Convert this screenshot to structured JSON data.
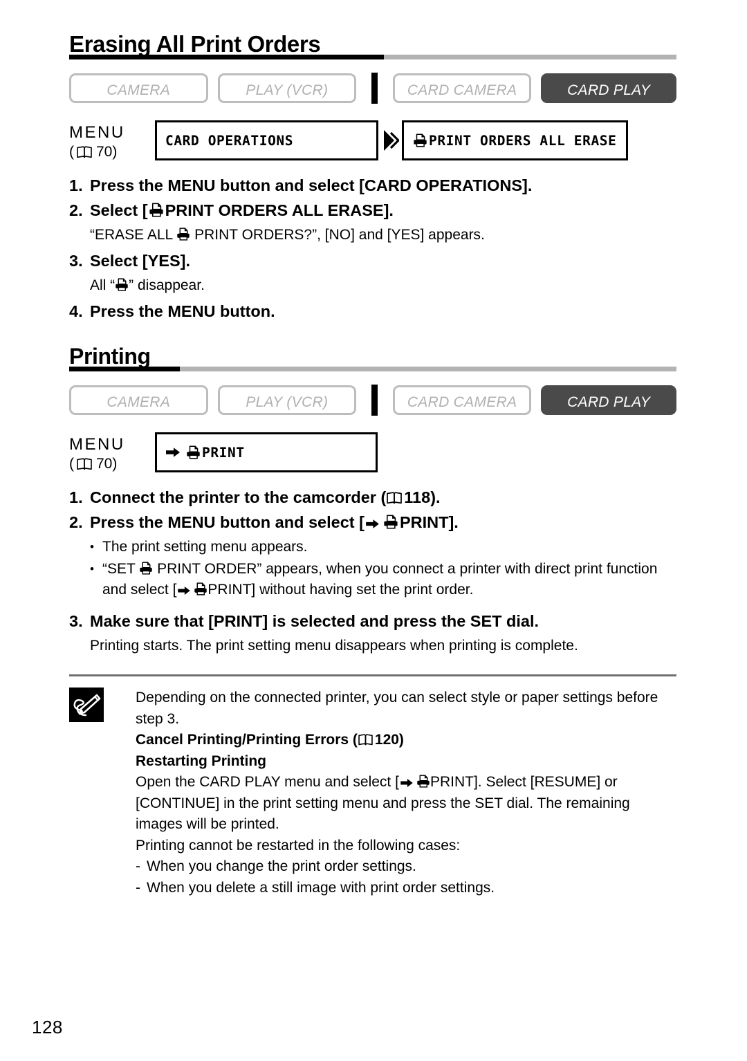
{
  "page": {
    "number": "128"
  },
  "sections": [
    {
      "id": "erasing",
      "title": "Erasing All Print Orders",
      "modebar": {
        "buttons": [
          {
            "label": "CAMERA",
            "active": false
          },
          {
            "label": "PLAY (VCR)",
            "active": false
          },
          {
            "label": "CARD CAMERA",
            "active": false
          },
          {
            "label": "CARD PLAY",
            "active": true
          }
        ]
      },
      "menu": {
        "label": "MENU",
        "ref_prefix": "(",
        "ref_page": "70)",
        "box1": "CARD OPERATIONS",
        "box2": "PRINT ORDERS ALL ERASE"
      },
      "steps": [
        {
          "num": "1.",
          "text": "Press the MENU button and select [CARD OPERATIONS]."
        },
        {
          "num": "2.",
          "text_pre": "Select [",
          "text_post": "PRINT ORDERS ALL ERASE].",
          "sub_pre": "“ERASE ALL ",
          "sub_post": " PRINT ORDERS?”, [NO] and [YES] appears."
        },
        {
          "num": "3.",
          "text": "Select [YES].",
          "sub_pre": "All “",
          "sub_post": "” disappear."
        },
        {
          "num": "4.",
          "text": "Press the MENU button."
        }
      ]
    },
    {
      "id": "printing",
      "title": "Printing",
      "modebar": {
        "buttons": [
          {
            "label": "CAMERA",
            "active": false
          },
          {
            "label": "PLAY (VCR)",
            "active": false
          },
          {
            "label": "CARD CAMERA",
            "active": false
          },
          {
            "label": "CARD PLAY",
            "active": true
          }
        ]
      },
      "menu": {
        "label": "MENU",
        "ref_page": "70)",
        "box1": "PRINT"
      },
      "steps": [
        {
          "num": "1.",
          "text_pre": "Connect the printer to the camcorder (",
          "text_post": "118)."
        },
        {
          "num": "2.",
          "text_pre": "Press the MENU button and select [",
          "text_post": "PRINT].",
          "bullets": [
            {
              "text": "The print setting menu appears."
            },
            {
              "text_a": "“SET ",
              "text_b": " PRINT ORDER” appears, when you connect a printer with direct print function and select [",
              "text_c": "PRINT] without having set the print order."
            }
          ]
        },
        {
          "num": "3.",
          "text": "Make sure that [PRINT] is selected and press the SET dial.",
          "sub": "Printing starts. The print setting menu disappears when printing is complete."
        }
      ]
    }
  ],
  "note": {
    "line1": "Depending on the connected printer, you can select style or paper settings before step 3.",
    "heading1_pre": "Cancel Printing/Printing Errors (",
    "heading1_page": "120)",
    "heading2": "Restarting Printing",
    "body_a": "Open the CARD PLAY menu and select [",
    "body_b": "PRINT]. Select [RESUME] or [CONTINUE] in the print setting menu and press the SET dial. The remaining images will be printed.",
    "line_cases": "Printing cannot be restarted in the following cases:",
    "dash1": "When you change the print order settings.",
    "dash2": "When you delete a still image with print order settings.",
    "dash_mark": "-"
  },
  "icons": {
    "print": "print-icon",
    "book": "book-icon",
    "arrow_right": "arrow-right-icon",
    "arrow_double": "double-chevron-icon",
    "memo": "memo-pencil-icon"
  },
  "colors": {
    "active_mode": "#4a4a4a",
    "inactive_border": "#bdbdbd",
    "inactive_text": "#b0b0b0",
    "heading_rule_gray": "#b3b3b3",
    "heading_rule_black": "#000000"
  }
}
